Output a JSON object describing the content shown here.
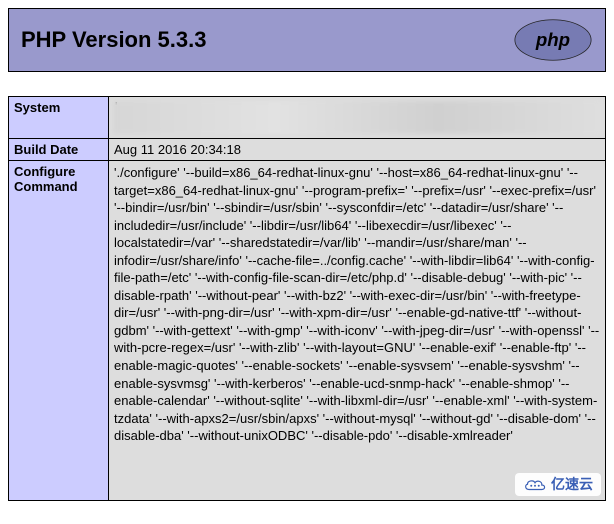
{
  "header": {
    "title": "PHP Version 5.3.3",
    "logo_label": "php"
  },
  "rows": {
    "system": {
      "label": "System",
      "value": ""
    },
    "build_date": {
      "label": "Build Date",
      "value": "Aug 11 2016 20:34:18"
    },
    "configure": {
      "label": "Configure Command",
      "value": "'./configure' '--build=x86_64-redhat-linux-gnu' '--host=x86_64-redhat-linux-gnu' '--target=x86_64-redhat-linux-gnu' '--program-prefix=' '--prefix=/usr' '--exec-prefix=/usr' '--bindir=/usr/bin' '--sbindir=/usr/sbin' '--sysconfdir=/etc' '--datadir=/usr/share' '--includedir=/usr/include' '--libdir=/usr/lib64' '--libexecdir=/usr/libexec' '--localstatedir=/var' '--sharedstatedir=/var/lib' '--mandir=/usr/share/man' '--infodir=/usr/share/info' '--cache-file=../config.cache' '--with-libdir=lib64' '--with-config-file-path=/etc' '--with-config-file-scan-dir=/etc/php.d' '--disable-debug' '--with-pic' '--disable-rpath' '--without-pear' '--with-bz2' '--with-exec-dir=/usr/bin' '--with-freetype-dir=/usr' '--with-png-dir=/usr' '--with-xpm-dir=/usr' '--enable-gd-native-ttf' '--without-gdbm' '--with-gettext' '--with-gmp' '--with-iconv' '--with-jpeg-dir=/usr' '--with-openssl' '--with-pcre-regex=/usr' '--with-zlib' '--with-layout=GNU' '--enable-exif' '--enable-ftp' '--enable-magic-quotes' '--enable-sockets' '--enable-sysvsem' '--enable-sysvshm' '--enable-sysvmsg' '--with-kerberos' '--enable-ucd-snmp-hack' '--enable-shmop' '--enable-calendar' '--without-sqlite' '--with-libxml-dir=/usr' '--enable-xml' '--with-system-tzdata' '--with-apxs2=/usr/sbin/apxs' '--without-mysql' '--without-gd' '--disable-dom' '--disable-dba' '--without-unixODBC' '--disable-pdo' '--disable-xmlreader'"
    }
  },
  "watermark": {
    "text": "亿速云"
  }
}
